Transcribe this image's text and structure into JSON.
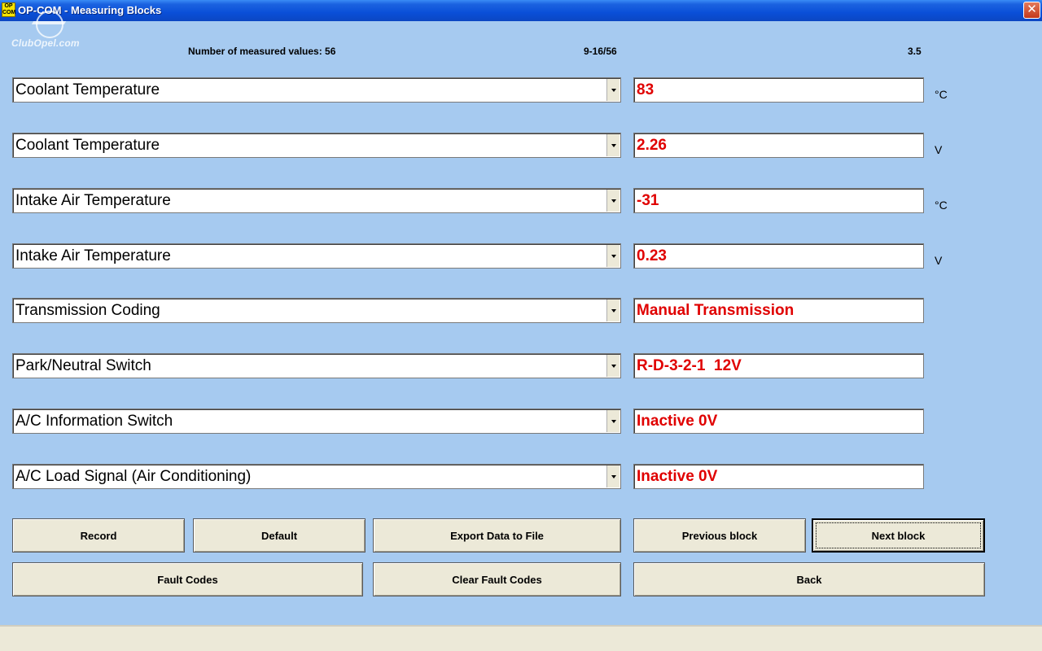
{
  "window": {
    "icon_text": "OP COM",
    "title": "OP-COM - Measuring Blocks",
    "close_glyph": "✕"
  },
  "watermark": {
    "text": "ClubOpel.com"
  },
  "info": {
    "measured_count": "Number of measured values: 56",
    "range": "9-16/56",
    "version": "3.5"
  },
  "rows": [
    {
      "label": "Coolant Temperature",
      "value": "83",
      "unit": "°C"
    },
    {
      "label": "Coolant Temperature",
      "value": "2.26",
      "unit": "V"
    },
    {
      "label": "Intake Air Temperature",
      "value": "-31",
      "unit": "°C"
    },
    {
      "label": "Intake Air Temperature",
      "value": "0.23",
      "unit": "V"
    },
    {
      "label": "Transmission Coding",
      "value": "Manual Transmission",
      "unit": ""
    },
    {
      "label": "Park/Neutral Switch",
      "value": "R-D-3-2-1  12V",
      "unit": ""
    },
    {
      "label": "A/C Information Switch",
      "value": "Inactive 0V",
      "unit": ""
    },
    {
      "label": "A/C Load Signal (Air Conditioning)",
      "value": "Inactive 0V",
      "unit": ""
    }
  ],
  "buttons": {
    "record": "Record",
    "default": "Default",
    "export": "Export Data to File",
    "previous": "Previous block",
    "next": "Next block",
    "fault_codes": "Fault Codes",
    "clear_fault_codes": "Clear Fault Codes",
    "back": "Back"
  },
  "colors": {
    "background": "#A6CAF0",
    "value_text": "#E00000",
    "button_face": "#ECE9D8"
  }
}
